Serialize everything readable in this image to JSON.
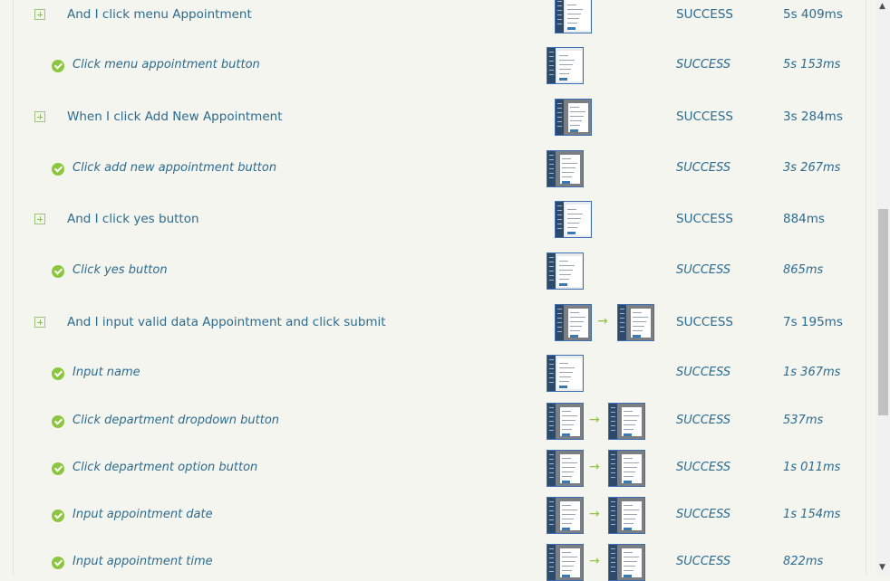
{
  "rows": [
    {
      "kind": "step",
      "label": "And I click menu Appointment",
      "status": "SUCCESS",
      "duration": "5s 409ms",
      "shots": 1
    },
    {
      "kind": "sub",
      "label": "Click menu appointment button",
      "status": "SUCCESS",
      "duration": "5s 153ms",
      "shots": 1
    },
    {
      "kind": "step",
      "label": "When I click Add New Appointment",
      "status": "SUCCESS",
      "duration": "3s 284ms",
      "shots": 1
    },
    {
      "kind": "sub",
      "label": "Click add new appointment button",
      "status": "SUCCESS",
      "duration": "3s 267ms",
      "shots": 1
    },
    {
      "kind": "step",
      "label": "And I click yes button",
      "status": "SUCCESS",
      "duration": "884ms",
      "shots": 1
    },
    {
      "kind": "sub",
      "label": "Click yes button",
      "status": "SUCCESS",
      "duration": "865ms",
      "shots": 1
    },
    {
      "kind": "step",
      "label": "And I input valid data Appointment and click submit",
      "status": "SUCCESS",
      "duration": "7s 195ms",
      "shots": 2
    },
    {
      "kind": "sub",
      "label": "Input name",
      "status": "SUCCESS",
      "duration": "1s 367ms",
      "shots": 1
    },
    {
      "kind": "sub",
      "label": "Click department dropdown button",
      "status": "SUCCESS",
      "duration": "537ms",
      "shots": 2
    },
    {
      "kind": "sub",
      "label": "Click department option button",
      "status": "SUCCESS",
      "duration": "1s 011ms",
      "shots": 2
    },
    {
      "kind": "sub",
      "label": "Input appointment date",
      "status": "SUCCESS",
      "duration": "1s 154ms",
      "shots": 2
    },
    {
      "kind": "sub",
      "label": "Input appointment time",
      "status": "SUCCESS",
      "duration": "822ms",
      "shots": 2
    }
  ],
  "arrow_glyph": "→",
  "icons": {
    "expand": "plus-square-icon",
    "success": "check-circle-icon"
  },
  "colors": {
    "text": "#2d6b8f",
    "success": "#8cc63f",
    "background": "#f4f5ee"
  }
}
